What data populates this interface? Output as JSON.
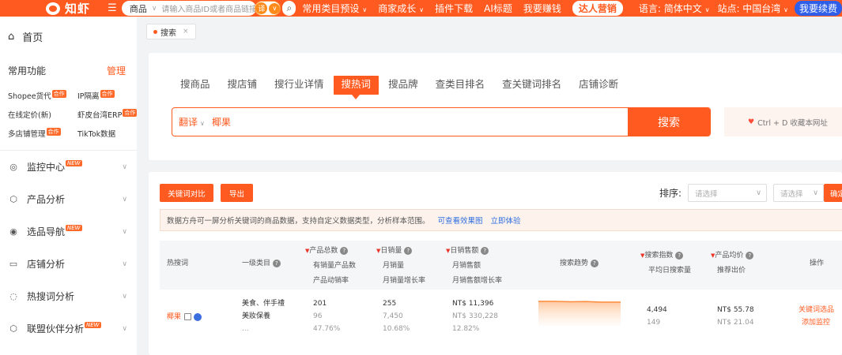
{
  "header": {
    "logo_text": "知虾",
    "menu_icon": "menu-icon",
    "search_category": "商品",
    "search_placeholder": "请输入商品ID或者商品链接",
    "translate_label": "译",
    "links": [
      {
        "label": "常用类目预设",
        "has_caret": true
      },
      {
        "label": "商家成长",
        "has_caret": true
      },
      {
        "label": "插件下载",
        "has_caret": false
      },
      {
        "label": "AI标题",
        "has_caret": false
      },
      {
        "label": "我要赚钱",
        "has_caret": false
      }
    ],
    "talent_label": "达人营销",
    "language": "语言: 简体中文",
    "site": "站点: 中国台湾",
    "renew_label": "我要续费"
  },
  "sidebar": {
    "home": "首页",
    "common_title": "常用功能",
    "manage": "管理",
    "tools": [
      {
        "label": "Shopee货代",
        "tag": "合作"
      },
      {
        "label": "IP隔离",
        "tag": "合作"
      },
      {
        "label": "在线定价(新)",
        "tag": ""
      },
      {
        "label": "虾皮台湾ERP",
        "tag": "合作"
      },
      {
        "label": "多店铺管理",
        "tag": "合作"
      },
      {
        "label": "TikTok数据",
        "tag": ""
      }
    ],
    "nav": [
      {
        "label": "监控中心",
        "icon": "location-icon",
        "tag": "NEW"
      },
      {
        "label": "产品分析",
        "icon": "box-icon",
        "tag": ""
      },
      {
        "label": "选品导航",
        "icon": "compass-icon",
        "tag": "NEW"
      },
      {
        "label": "店铺分析",
        "icon": "store-icon",
        "tag": ""
      },
      {
        "label": "热搜词分析",
        "icon": "chat-icon",
        "tag": ""
      },
      {
        "label": "联盟伙伴分析",
        "icon": "link-icon",
        "tag": "NEW"
      }
    ]
  },
  "page_tab": {
    "label": "搜索",
    "close": "×"
  },
  "search_card": {
    "tabs": [
      "搜商品",
      "搜店铺",
      "搜行业详情",
      "搜热词",
      "搜品牌",
      "查类目排名",
      "查关键词排名",
      "店铺诊断"
    ],
    "active_tab": "搜热词",
    "translate": "翻译",
    "query": "椰果",
    "search_button": "搜索",
    "bookmark": "Ctrl + D 收藏本网址"
  },
  "results": {
    "compare_button": "关键词对比",
    "export_button": "导出",
    "sort_label": "排序:",
    "select_placeholder_1": "请选择",
    "select_placeholder_2": "请选择",
    "confirm_button": "确定",
    "notice_text": "数据方舟可一屏分析关键词的商品数据，支持自定义数据类型，分析样本范围。",
    "notice_link_1": "可查看效果图",
    "notice_link_2": "立即体验",
    "columns": {
      "hot_word": "热搜词",
      "category": "一级类目",
      "product_total": "产品总数",
      "product_total_sub1": "有销量产品数",
      "product_total_sub2": "产品动销率",
      "daily_sales": "日销量",
      "daily_sales_sub1": "月销量",
      "daily_sales_sub2": "月销量增长率",
      "daily_revenue": "日销售额",
      "daily_revenue_sub1": "月销售额",
      "daily_revenue_sub2": "月销售额增长率",
      "trend": "搜索趋势",
      "search_index": "搜索指数",
      "search_index_sub": "平均日搜索量",
      "avg_price": "产品均价",
      "avg_price_sub": "推荐出价",
      "ops": "操作"
    },
    "row": {
      "keyword": "椰果",
      "category_1": "美食、伴手禮",
      "category_2": "美妝保養",
      "category_more": "...",
      "product_total": "201",
      "with_sales": "96",
      "sell_through": "47.76%",
      "daily_sales": "255",
      "monthly_sales": "7,450",
      "monthly_sales_growth": "10.68%",
      "daily_revenue": "NT$ 11,396",
      "monthly_revenue": "NT$ 330,228",
      "monthly_revenue_growth": "12.82%",
      "search_index": "4,494",
      "avg_daily_search": "149",
      "avg_price": "NT$ 55.78",
      "suggested_bid": "NT$ 21.04",
      "action_1": "关键词选品",
      "action_2": "添加监控"
    },
    "trend_color": "#ff8c3a",
    "accent_color": "#ff5a1f"
  }
}
